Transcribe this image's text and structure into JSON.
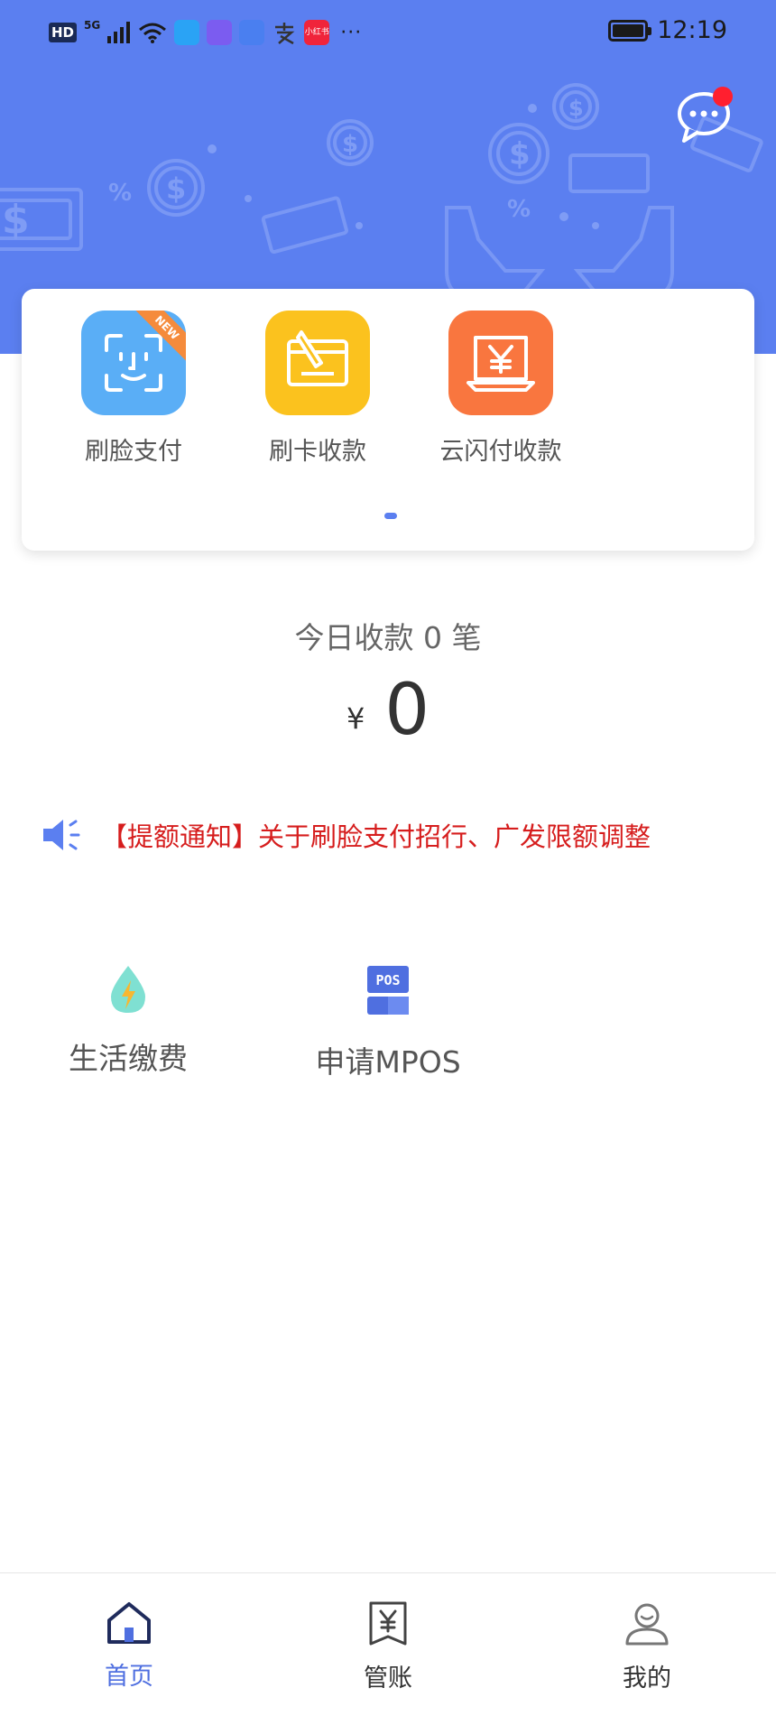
{
  "status_bar": {
    "network_hd": "HD",
    "network_5g": "5G",
    "app_icon_colors": [
      "#2aa3f5",
      "#7b5cf0",
      "#4a7ff0",
      "#333333",
      "#f0243b"
    ],
    "app_icon_names": [
      "telegram-icon",
      "app-icon",
      "education-icon",
      "alipay-icon",
      "xiaohongshu-icon"
    ],
    "xiaohongshu_label": "小红书",
    "more": "···",
    "time": "12:19"
  },
  "header": {
    "bg_color": "#5b7ff0",
    "message_icon": "chat-bubble-icon",
    "has_unread": true
  },
  "quick_pay": {
    "items": [
      {
        "label": "刷脸支付",
        "icon": "face-scan-icon",
        "color": "#5aaef6",
        "badge": "NEW"
      },
      {
        "label": "刷卡收款",
        "icon": "card-swipe-icon",
        "color": "#fbc21e"
      },
      {
        "label": "云闪付收款",
        "icon": "quick-pass-icon",
        "color": "#f9763f"
      }
    ],
    "page_indicator": 1
  },
  "summary": {
    "title": "今日收款 0 笔",
    "currency": "¥",
    "amount": "0"
  },
  "notice": {
    "icon": "speaker-icon",
    "text": "【提额通知】关于刷脸支付招行、广发限额调整",
    "color": "#d61d1d"
  },
  "services": [
    {
      "label": "生活缴费",
      "icon": "utility-drop-icon"
    },
    {
      "label": "申请MPOS",
      "icon": "pos-icon"
    }
  ],
  "tabbar": {
    "tabs": [
      {
        "label": "首页",
        "icon": "home-icon",
        "active": true
      },
      {
        "label": "管账",
        "icon": "ledger-icon",
        "active": false
      },
      {
        "label": "我的",
        "icon": "user-icon",
        "active": false
      }
    ],
    "active_color": "#4f6fe0",
    "inactive_color": "#333333"
  }
}
